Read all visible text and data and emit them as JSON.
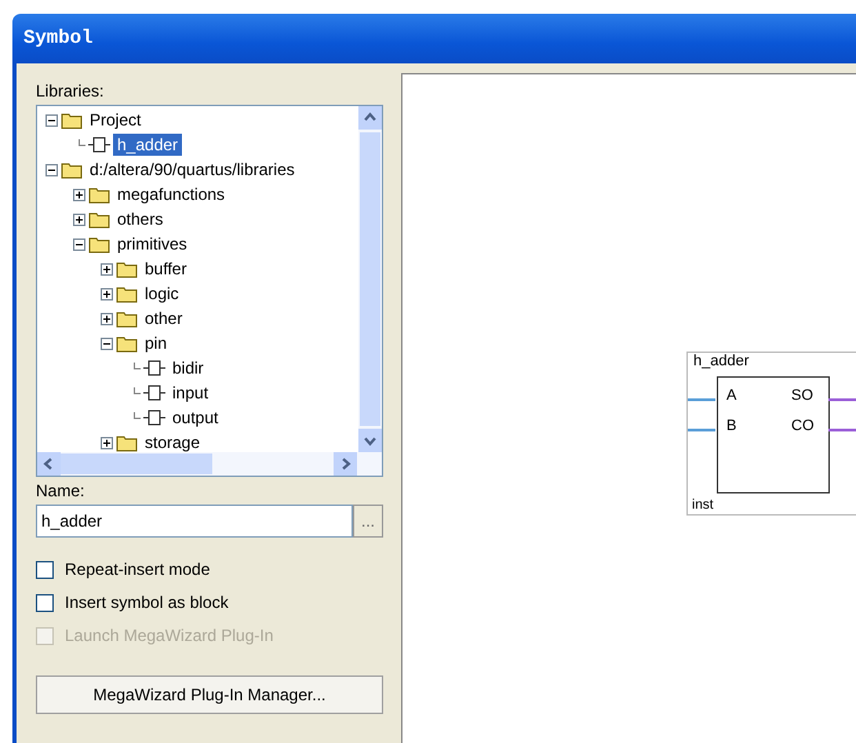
{
  "window": {
    "title": "Symbol"
  },
  "libraries": {
    "label": "Libraries:",
    "tree": [
      {
        "label": "Project",
        "kind": "folder",
        "expanded": true,
        "selected": false,
        "children": [
          {
            "label": "h_adder",
            "kind": "symbol",
            "selected": true
          }
        ]
      },
      {
        "label": "d:/altera/90/quartus/libraries",
        "kind": "folder",
        "expanded": true,
        "selected": false,
        "children": [
          {
            "label": "megafunctions",
            "kind": "folder",
            "expanded": false,
            "selected": false
          },
          {
            "label": "others",
            "kind": "folder",
            "expanded": false,
            "selected": false
          },
          {
            "label": "primitives",
            "kind": "folder",
            "expanded": true,
            "selected": false,
            "children": [
              {
                "label": "buffer",
                "kind": "folder",
                "expanded": false,
                "selected": false
              },
              {
                "label": "logic",
                "kind": "folder",
                "expanded": false,
                "selected": false
              },
              {
                "label": "other",
                "kind": "folder",
                "expanded": false,
                "selected": false
              },
              {
                "label": "pin",
                "kind": "folder",
                "expanded": true,
                "selected": false,
                "children": [
                  {
                    "label": "bidir",
                    "kind": "symbol",
                    "selected": false
                  },
                  {
                    "label": "input",
                    "kind": "symbol",
                    "selected": false
                  },
                  {
                    "label": "output",
                    "kind": "symbol",
                    "selected": false
                  }
                ]
              },
              {
                "label": "storage",
                "kind": "folder",
                "expanded": false,
                "selected": false
              }
            ]
          }
        ]
      }
    ]
  },
  "name": {
    "label": "Name:",
    "value": "h_adder",
    "browse": "..."
  },
  "options": [
    {
      "label": "Repeat-insert mode",
      "checked": false,
      "disabled": false
    },
    {
      "label": "Insert symbol as block",
      "checked": false,
      "disabled": false
    },
    {
      "label": "Launch MegaWizard Plug-In",
      "checked": false,
      "disabled": true
    }
  ],
  "manager_button": "MegaWizard Plug-In Manager...",
  "preview": {
    "symbol": {
      "name": "h_adder",
      "inputs": [
        "A",
        "B"
      ],
      "outputs": [
        "SO",
        "CO"
      ],
      "instance": "inst"
    }
  }
}
